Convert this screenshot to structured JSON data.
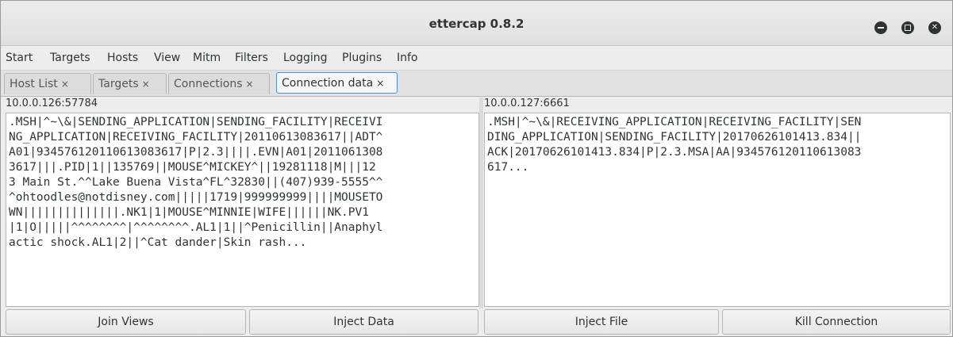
{
  "window": {
    "title": "ettercap 0.8.2"
  },
  "menu": [
    "Start",
    "Targets",
    "Hosts",
    "View",
    "Mitm",
    "Filters",
    "Logging",
    "Plugins",
    "Info"
  ],
  "tabs": [
    {
      "label": "Host List",
      "close": "×"
    },
    {
      "label": "Targets",
      "close": "×"
    },
    {
      "label": "Connections",
      "close": "×"
    },
    {
      "label": "Connection data",
      "close": "×",
      "active": true
    }
  ],
  "left_pane": {
    "address": "10.0.0.126:57784",
    "lines": [
      ".MSH|^~\\&|SENDING_APPLICATION|SENDING_FACILITY|RECEIVI",
      "NG_APPLICATION|RECEIVING_FACILITY|20110613083617||ADT^",
      "A01|934576120110613083617|P|2.3||||.EVN|A01|2011061308",
      "3617|||.PID|1||135769||MOUSE^MICKEY^||19281118|M|||12",
      "3 Main St.^^Lake Buena Vista^FL^32830||(407)939-5555^^",
      "^ohtoodles@notdisney.com|||||1719|999999999||||MOUSETO",
      "WN||||||||||||||.NK1|1|MOUSE^MINNIE|WIFE||||||NK.PV1",
      "|1|O|||||^^^^^^^^|^^^^^^^^.AL1|1||^Penicillin||Anaphyl",
      "actic shock.AL1|2||^Cat dander|Skin rash..."
    ]
  },
  "right_pane": {
    "address": "10.0.0.127:6661",
    "lines": [
      ".MSH|^~\\&|RECEIVING_APPLICATION|RECEIVING_FACILITY|SEN",
      "DING_APPLICATION|SENDING_FACILITY|20170626101413.834||",
      "ACK|20170626101413.834|P|2.3.MSA|AA|934576120110613083",
      "617..."
    ]
  },
  "buttons": {
    "join_views": "Join Views",
    "inject_data": "Inject Data",
    "inject_file": "Inject File",
    "kill_connection": "Kill Connection"
  },
  "colors": {
    "active_tab_border": "#4a90d9",
    "window_button": "#2e3436"
  },
  "icons": {
    "minimize": "minimize-icon",
    "maximize": "maximize-icon",
    "close": "close-icon"
  }
}
